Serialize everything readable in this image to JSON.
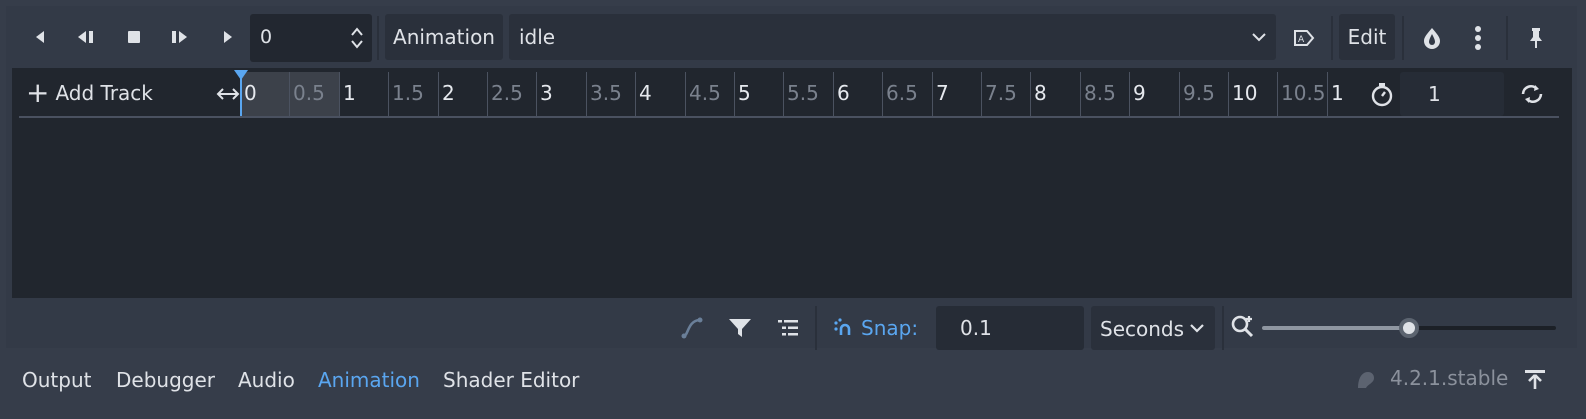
{
  "toolbar": {
    "frame_value": "0",
    "animation_label": "Animation",
    "current_animation": "idle",
    "edit_label": "Edit"
  },
  "timeline": {
    "add_track_label": "Add Track",
    "ticks": [
      "0",
      "0.5",
      "1",
      "1.5",
      "2",
      "2.5",
      "3",
      "3.5",
      "4",
      "4.5",
      "5",
      "5.5",
      "6",
      "6.5",
      "7",
      "7.5",
      "8",
      "8.5",
      "9",
      "9.5",
      "10",
      "10.5",
      "1"
    ],
    "length_value": "1",
    "playhead_time": 0,
    "colors": {
      "accent": "#5aa6f0",
      "major_tick": "#e6e9ee",
      "minor_tick": "#7a818d"
    }
  },
  "bottom_bar": {
    "snap_label": "Snap:",
    "snap_value": "0.1",
    "unit_value": "Seconds",
    "zoom_level": 0.5
  },
  "dock": {
    "tabs": [
      {
        "label": "Output",
        "active": false
      },
      {
        "label": "Debugger",
        "active": false
      },
      {
        "label": "Audio",
        "active": false
      },
      {
        "label": "Animation",
        "active": true
      },
      {
        "label": "Shader Editor",
        "active": false
      }
    ],
    "version": "4.2.1.stable"
  },
  "icons": [
    "play-backwards-icon",
    "play-backwards-from-end-icon",
    "stop-icon",
    "play-from-start-icon",
    "play-icon",
    "autoplay-icon",
    "onion-skin-icon",
    "more-menu-icon",
    "pin-icon",
    "fit-width-icon",
    "timer-icon",
    "loop-icon",
    "bezier-icon",
    "filter-icon",
    "track-list-icon",
    "snap-icon",
    "zoom-icon",
    "godot-icon",
    "collapse-panel-icon"
  ]
}
